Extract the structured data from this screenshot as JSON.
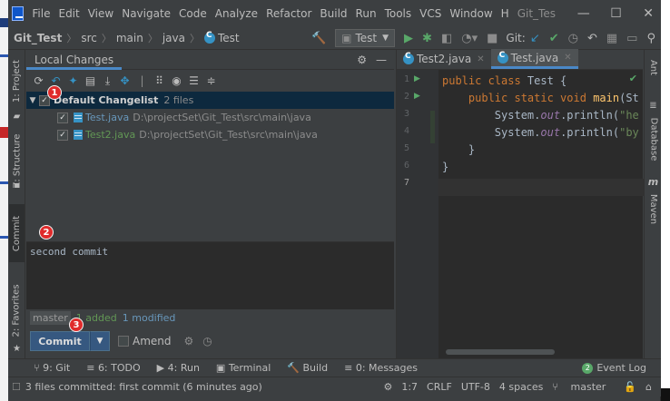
{
  "menu": {
    "items": [
      "File",
      "Edit",
      "View",
      "Navigate",
      "Code",
      "Analyze",
      "Refactor",
      "Build",
      "Run",
      "Tools",
      "VCS",
      "Window",
      "H"
    ],
    "underline": [
      "F",
      "E",
      "V",
      "N",
      "C",
      "z",
      "R",
      "B",
      "u",
      "T",
      "S",
      "W",
      "H"
    ],
    "window_title": "Git_Tes",
    "minimize": "—",
    "maximize": "☐",
    "close": "✕"
  },
  "breadcrumb": {
    "project": "Git_Test",
    "parts": [
      "src",
      "main",
      "java"
    ],
    "file": "Test"
  },
  "toolbar": {
    "run_config": "Test",
    "git_label": "Git:"
  },
  "left_tabs": {
    "project": "1: Project",
    "structure": "Z: Structure",
    "commit": "Commit",
    "favorites": "2: Favorites"
  },
  "right_tabs": {
    "ant": "Ant",
    "database": "Database",
    "maven": "Maven"
  },
  "local_changes": {
    "tab_label": "Local Changes",
    "changelist_name": "Default Changelist",
    "changelist_count": "2 files",
    "files": [
      {
        "name": "Test.java",
        "path": "D:\\projectSet\\Git_Test\\src\\main\\java"
      },
      {
        "name": "Test2.java",
        "path": "D:\\projectSet\\Git_Test\\src\\main\\java"
      }
    ]
  },
  "commit": {
    "message": "second commit",
    "branch": "master",
    "added": "1 added",
    "modified": "1 modified",
    "button_label": "Commit",
    "amend_label": "Amend"
  },
  "badges": [
    "1",
    "2",
    "3"
  ],
  "editor": {
    "tabs": [
      {
        "name": "Test2.java",
        "active": false
      },
      {
        "name": "Test.java",
        "active": true
      }
    ],
    "line_numbers": [
      "1",
      "2",
      "3",
      "4",
      "5",
      "6",
      "7"
    ]
  },
  "bottom_tools": {
    "git": "9: Git",
    "todo": "6: TODO",
    "run": "4: Run",
    "terminal": "Terminal",
    "build": "Build",
    "messages": "0: Messages",
    "event_log": "Event Log",
    "event_count": "2"
  },
  "status": {
    "message": "3 files committed: first commit (6 minutes ago)",
    "position": "1:7",
    "line_sep": "CRLF",
    "encoding": "UTF-8",
    "indent": "4 spaces",
    "branch": "master"
  },
  "colors": {
    "background": "#3c3f41",
    "editor_bg": "#2b2b2b",
    "accent": "#4a88c7",
    "badge": "#e02b2b",
    "added": "#629755",
    "modified": "#6897bb"
  }
}
